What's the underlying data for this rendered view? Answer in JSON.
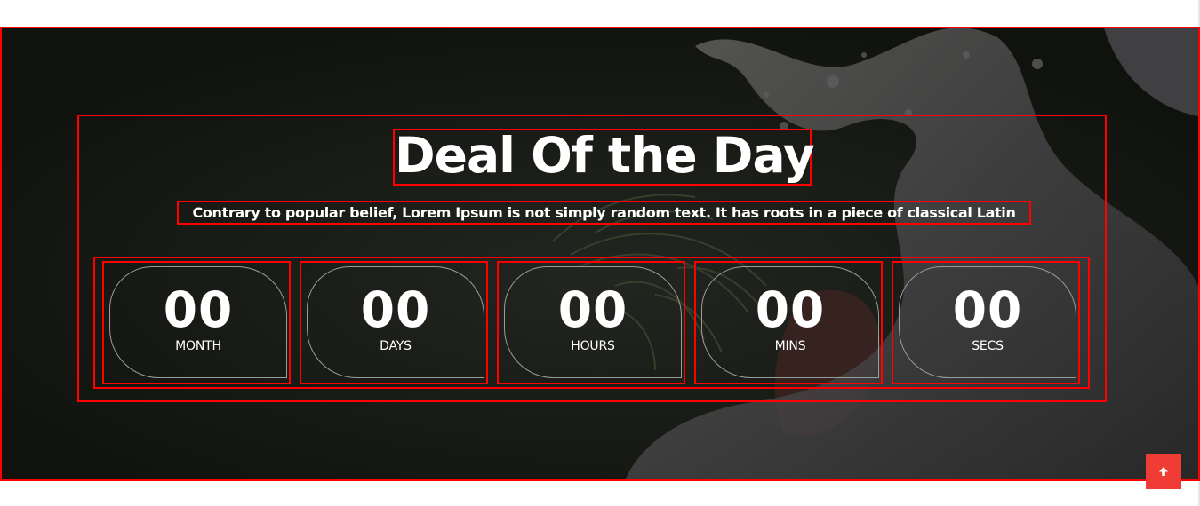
{
  "deal": {
    "title": "Deal Of the Day",
    "subtitle": "Contrary to popular belief, Lorem Ipsum is not simply random text. It has roots in a piece of classical Latin"
  },
  "countdown": [
    {
      "value": "00",
      "label": "MONTH"
    },
    {
      "value": "00",
      "label": "DAYS"
    },
    {
      "value": "00",
      "label": "HOURS"
    },
    {
      "value": "00",
      "label": "MINS"
    },
    {
      "value": "00",
      "label": "SECS"
    }
  ],
  "scroll_top": {
    "icon": "arrow-up-icon"
  },
  "colors": {
    "section_background": "#131510",
    "outline": "#ff0000",
    "text": "#ffffff",
    "card_border": "#9a9c96",
    "scroll_button": "#ef3d36"
  }
}
